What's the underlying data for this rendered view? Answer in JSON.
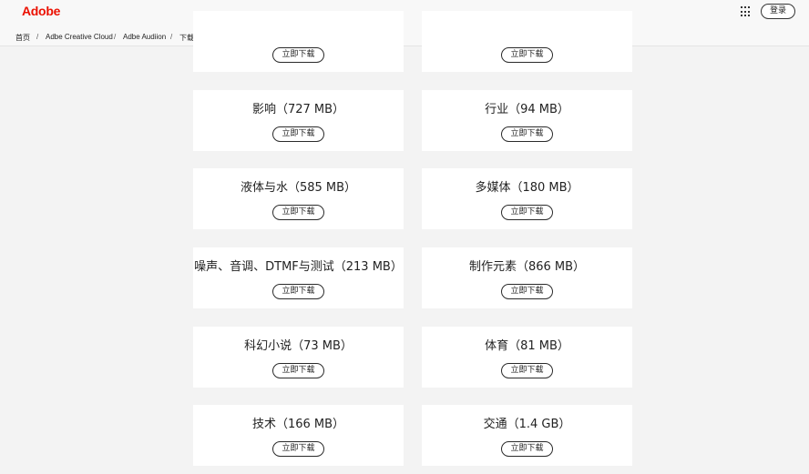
{
  "header": {
    "logo": "Adobe",
    "login_label": "登录"
  },
  "breadcrumb": {
    "items": [
      "首页",
      "Adbe Creative Cloud",
      "Adbe Audiion",
      "下载音效"
    ],
    "separator": "/"
  },
  "cards": [
    {
      "title": "",
      "button": "立即下载"
    },
    {
      "title": "",
      "button": "立即下载"
    },
    {
      "title": "影响（727 MB）",
      "button": "立即下载"
    },
    {
      "title": "行业（94 MB）",
      "button": "立即下载"
    },
    {
      "title": "液体与水（585 MB）",
      "button": "立即下载"
    },
    {
      "title": "多媒体（180 MB）",
      "button": "立即下载"
    },
    {
      "title": "噪声、音调、DTMF与测试（213 MB）",
      "button": "立即下载"
    },
    {
      "title": "制作元素（866 MB）",
      "button": "立即下载"
    },
    {
      "title": "科幻小说（73 MB）",
      "button": "立即下载"
    },
    {
      "title": "体育（81 MB）",
      "button": "立即下载"
    },
    {
      "title": "技术（166 MB）",
      "button": "立即下载"
    },
    {
      "title": "交通（1.4 GB）",
      "button": "立即下载"
    }
  ],
  "colors": {
    "brand": "#eb1000",
    "background": "#f3f3f3",
    "card": "#ffffff"
  },
  "icons": [
    "apps-grid-icon",
    "ring-icon"
  ]
}
